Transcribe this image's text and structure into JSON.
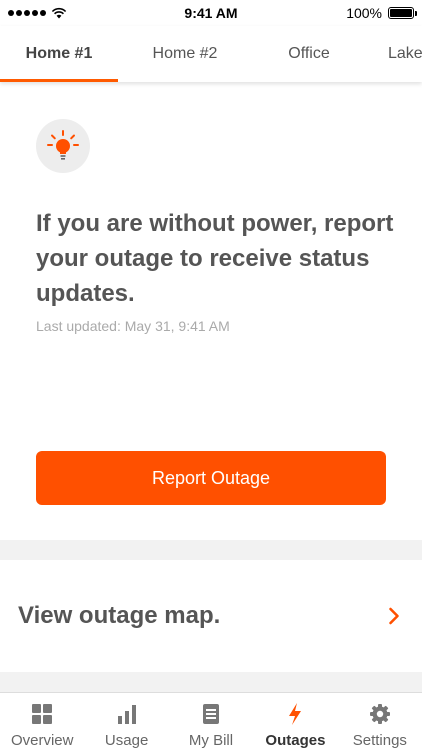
{
  "status_bar": {
    "time": "9:41 AM",
    "battery_text": "100%",
    "battery_level": 1.0
  },
  "tabs": [
    {
      "label": "Home #1",
      "active": true
    },
    {
      "label": "Home #2",
      "active": false
    },
    {
      "label": "Office",
      "active": false
    },
    {
      "label": "Lake",
      "active": false
    }
  ],
  "outage_card": {
    "icon": "lightbulb-icon",
    "headline": "If you are without power, report your outage to receive status updates.",
    "last_updated": "Last updated: May 31, 9:41 AM",
    "report_button": "Report Outage"
  },
  "outage_map": {
    "label": "View outage map.",
    "icon": "chevron-right-icon"
  },
  "bottom_nav": [
    {
      "label": "Overview",
      "icon": "grid-icon",
      "active": false
    },
    {
      "label": "Usage",
      "icon": "bar-chart-icon",
      "active": false
    },
    {
      "label": "My Bill",
      "icon": "document-icon",
      "active": false
    },
    {
      "label": "Outages",
      "icon": "lightning-icon",
      "active": true
    },
    {
      "label": "Settings",
      "icon": "gear-icon",
      "active": false
    }
  ],
  "colors": {
    "accent": "#ff5000",
    "text": "#555555",
    "muted": "#aaaaaa",
    "background": "#f2f2f2"
  }
}
